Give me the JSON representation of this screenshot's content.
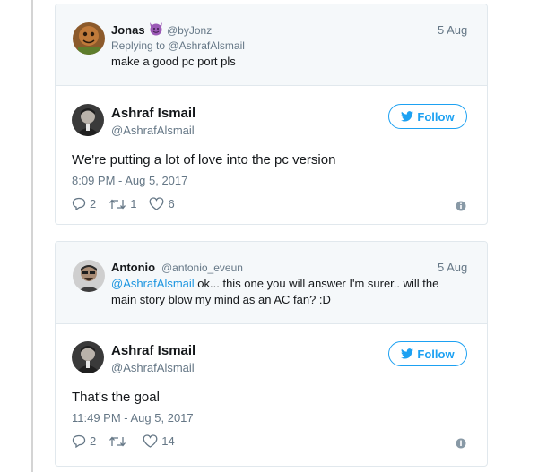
{
  "thread": [
    {
      "context": {
        "name": "Jonas",
        "emoji_icon": "smiling-devil-icon",
        "handle": "@byJonz",
        "date": "5 Aug",
        "replying_prefix": "Replying to",
        "replying_handle": "@AshrafAlsmail",
        "text": "make a good pc port pls"
      },
      "reply": {
        "name": "Ashraf Ismail",
        "handle": "@AshrafAlsmail",
        "follow_label": "Follow",
        "text": "We're putting a lot of love into the pc version",
        "timestamp": "8:09 PM - Aug 5, 2017",
        "replies": "2",
        "retweets": "1",
        "likes": "6"
      }
    },
    {
      "context": {
        "name": "Antonio",
        "handle": "@antonio_eveun",
        "date": "5 Aug",
        "mention": "@AshrafAlsmail",
        "text_line1": " ok... this one you will answer I'm surer.. will the",
        "text_line2": "main story blow my mind as an AC fan? :D"
      },
      "reply": {
        "name": "Ashraf Ismail",
        "handle": "@AshrafAlsmail",
        "follow_label": "Follow",
        "text": "That's the goal",
        "timestamp": "11:49 PM - Aug 5, 2017",
        "replies": "2",
        "retweets": "",
        "likes": "14"
      }
    }
  ],
  "colors": {
    "brand_blue": "#1da1f2",
    "mention_blue": "#1b95e0",
    "muted": "#657786",
    "text": "#14171a",
    "context_bg": "#f5f8fa",
    "border": "#e1e8ed"
  }
}
